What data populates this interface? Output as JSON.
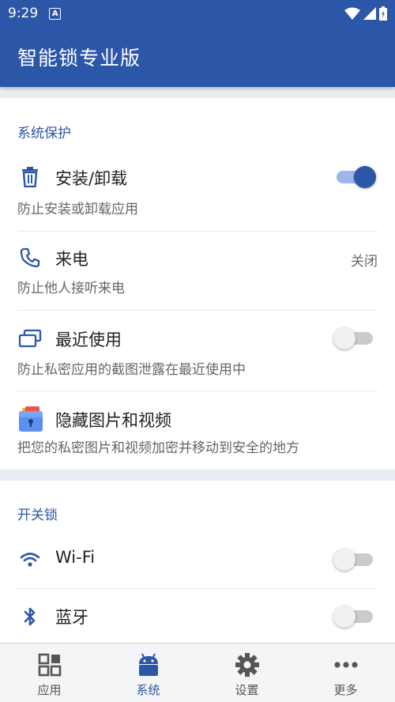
{
  "status_bar": {
    "time": "9:29",
    "notification_letter": "A"
  },
  "app_bar": {
    "title": "智能锁专业版"
  },
  "colors": {
    "primary": "#2c56a8",
    "background": "#e9edf2"
  },
  "system_protection": {
    "section_title": "系统保护",
    "items": [
      {
        "icon": "trash-icon",
        "label": "安装/卸载",
        "desc": "防止安装或卸载应用",
        "toggle": "on"
      },
      {
        "icon": "phone-icon",
        "label": "来电",
        "desc": "防止他人接听来电",
        "value": "关闭"
      },
      {
        "icon": "recent-apps-icon",
        "label": "最近使用",
        "desc": "防止私密应用的截图泄露在最近使用中",
        "toggle": "off"
      },
      {
        "icon": "vault-icon",
        "label": "隐藏图片和视频",
        "desc": "把您的私密图片和视频加密并移动到安全的地方"
      }
    ]
  },
  "switch_lock": {
    "section_title": "开关锁",
    "items": [
      {
        "icon": "wifi-icon",
        "label": "Wi-Fi",
        "toggle": "off"
      },
      {
        "icon": "bluetooth-icon",
        "label": "蓝牙",
        "toggle": "off"
      }
    ]
  },
  "bottom_nav": {
    "items": [
      {
        "icon": "grid-icon",
        "label": "应用",
        "active": false
      },
      {
        "icon": "android-icon",
        "label": "系统",
        "active": true
      },
      {
        "icon": "gear-icon",
        "label": "设置",
        "active": false
      },
      {
        "icon": "more-icon",
        "label": "更多",
        "active": false
      }
    ]
  }
}
